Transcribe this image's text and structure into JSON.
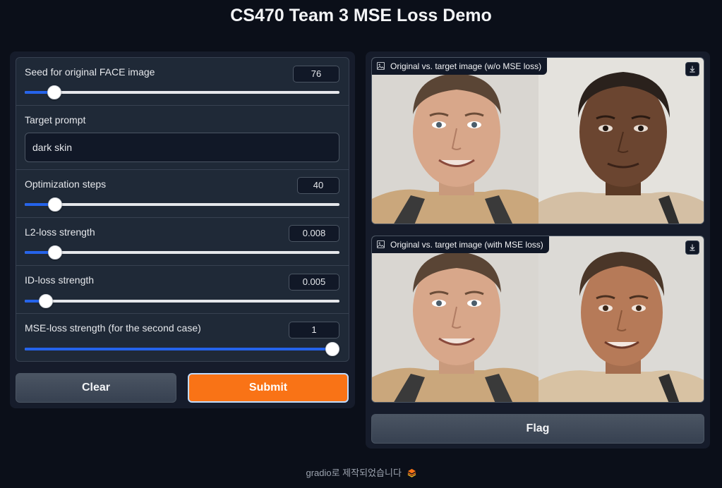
{
  "app": {
    "title": "CS470 Team 3 MSE Loss Demo"
  },
  "controls": {
    "seed": {
      "label": "Seed for original FACE image",
      "value": "76",
      "level": 0.1
    },
    "prompt": {
      "label": "Target prompt",
      "value": "dark skin"
    },
    "steps": {
      "label": "Optimization steps",
      "value": "40",
      "level": 0.1
    },
    "l2": {
      "label": "L2-loss strength",
      "value": "0.008",
      "level": 0.1
    },
    "id": {
      "label": "ID-loss strength",
      "value": "0.005",
      "level": 0.05
    },
    "mse": {
      "label": "MSE-loss strength (for the second case)",
      "value": "1",
      "level": 1.0
    }
  },
  "buttons": {
    "clear": "Clear",
    "submit": "Submit",
    "flag": "Flag"
  },
  "outputs": [
    {
      "label": "Original vs. target image (w/o MSE loss)"
    },
    {
      "label": "Original vs. target image (with MSE loss)"
    }
  ],
  "footer": {
    "text": "gradio로 제작되었습니다"
  },
  "colors": {
    "accent": "#f97316",
    "slider": "#2563eb",
    "background": "#0b0f19",
    "panel": "#1f2937"
  },
  "icons": [
    "image-icon",
    "download-icon",
    "gradio-logo-icon"
  ]
}
